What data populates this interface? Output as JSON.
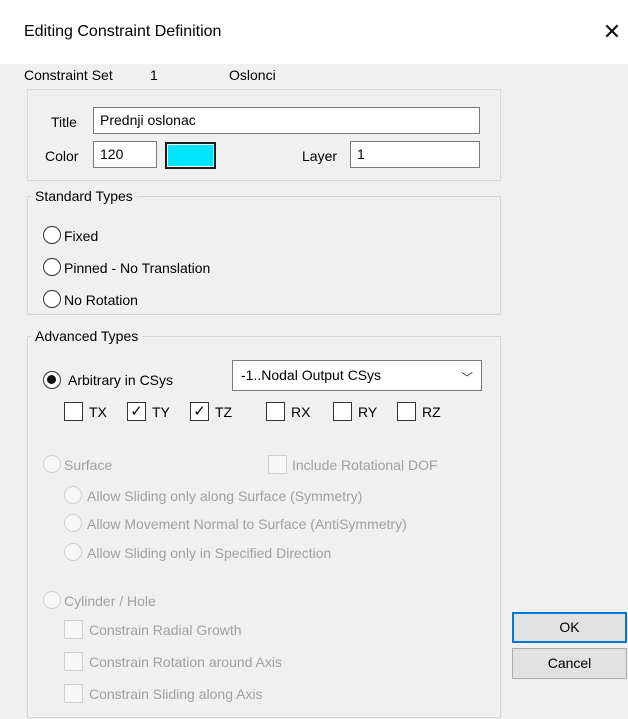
{
  "dialog": {
    "title": "Editing Constraint Definition",
    "close_icon": "close-icon"
  },
  "constraint_set": {
    "label": "Constraint Set",
    "number": "1",
    "name": "Oslonci"
  },
  "general": {
    "title_label": "Title",
    "title_value": "Prednji oslonac",
    "color_label": "Color",
    "color_value": "120",
    "color_swatch": "#00e5ff",
    "layer_label": "Layer",
    "layer_value": "1"
  },
  "standard_types": {
    "legend": "Standard Types",
    "options": [
      {
        "label": "Fixed",
        "checked": false
      },
      {
        "label": "Pinned - No Translation",
        "checked": false
      },
      {
        "label": "No Rotation",
        "checked": false
      }
    ]
  },
  "advanced_types": {
    "legend": "Advanced Types",
    "arbitrary_label": "Arbitrary in CSys",
    "arbitrary_checked": true,
    "csys_value": "-1..Nodal Output CSys",
    "dofs": [
      {
        "label": "TX",
        "checked": false
      },
      {
        "label": "TY",
        "checked": true
      },
      {
        "label": "TZ",
        "checked": true
      },
      {
        "label": "RX",
        "checked": false
      },
      {
        "label": "RY",
        "checked": false
      },
      {
        "label": "RZ",
        "checked": false
      }
    ],
    "surface_label": "Surface",
    "include_rotational_label": "Include Rotational DOF",
    "surface_options": [
      "Allow Sliding only along Surface (Symmetry)",
      "Allow Movement Normal to Surface (AntiSymmetry)",
      "Allow Sliding only in Specified Direction"
    ],
    "cylinder_label": "Cylinder / Hole",
    "cylinder_options": [
      "Constrain Radial Growth",
      "Constrain Rotation around Axis",
      "Constrain Sliding along Axis"
    ]
  },
  "buttons": {
    "ok": "OK",
    "cancel": "Cancel"
  }
}
